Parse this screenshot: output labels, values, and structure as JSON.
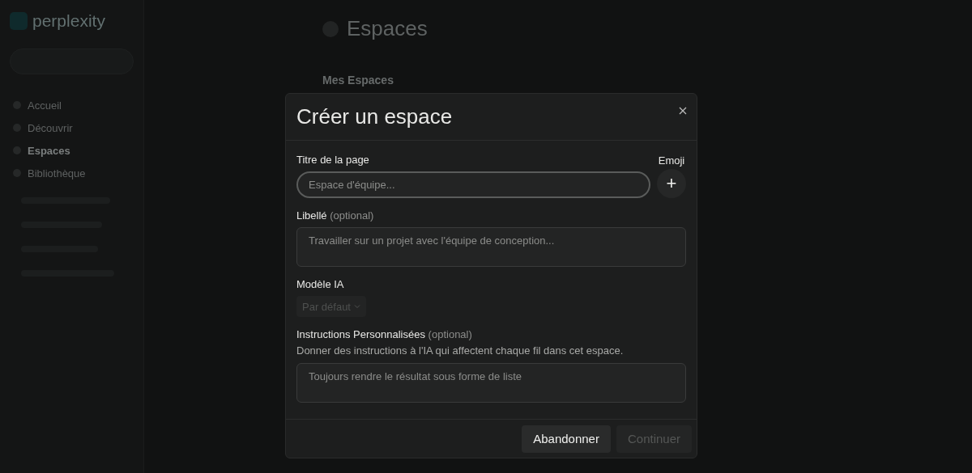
{
  "background": {
    "logo": "perplexity",
    "sidebar_items": [
      {
        "label": "Accueil",
        "selected": false
      },
      {
        "label": "Découvrir",
        "selected": false
      },
      {
        "label": "Espaces",
        "selected": true
      },
      {
        "label": "Bibliothèque",
        "selected": false
      }
    ],
    "page_title": "Espaces",
    "section_title": "Mes Espaces"
  },
  "dialog": {
    "title": "Créer un espace",
    "page_title_field": {
      "label": "Titre de la page",
      "placeholder": "Espace d'équipe...",
      "focused": true
    },
    "emoji": {
      "label": "Emoji",
      "button": "+"
    },
    "label_field": {
      "label": "Libellé",
      "note": "(optional)",
      "placeholder": "Travailler sur un projet avec l'équipe de conception..."
    },
    "model_field": {
      "label": "Modèle IA",
      "value": "Par défaut",
      "disabled": true
    },
    "instructions_field": {
      "label": "Instructions Personnalisées",
      "note": "(optional)",
      "description": "Donner des instructions à l'IA qui affectent chaque fil dans cet espace.",
      "placeholder": "Toujours rendre le résultat sous forme de liste"
    },
    "buttons": [
      {
        "label": "Abandonner",
        "disabled": false
      },
      {
        "label": "Continuer",
        "disabled": true
      }
    ]
  }
}
